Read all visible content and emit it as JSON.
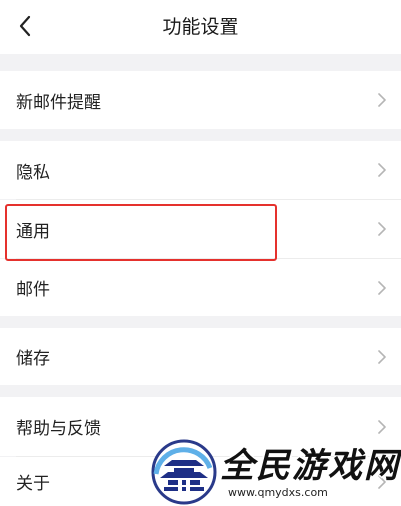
{
  "header": {
    "title": "功能设置"
  },
  "groups": [
    {
      "items": [
        {
          "label": "新邮件提醒"
        }
      ]
    },
    {
      "items": [
        {
          "label": "隐私"
        },
        {
          "label": "通用"
        },
        {
          "label": "邮件"
        }
      ]
    },
    {
      "items": [
        {
          "label": "储存"
        }
      ]
    },
    {
      "items": [
        {
          "label": "帮助与反馈"
        },
        {
          "label": "关于"
        }
      ]
    }
  ],
  "watermark": {
    "name": "全民游戏网",
    "url": "www.qmydxs.com"
  },
  "colors": {
    "highlight": "#e5312d",
    "background": "#f2f2f4",
    "chevron": "#b5b5b5"
  },
  "icons": {
    "back": "chevron-left-icon",
    "row_arrow": "chevron-right-icon"
  }
}
